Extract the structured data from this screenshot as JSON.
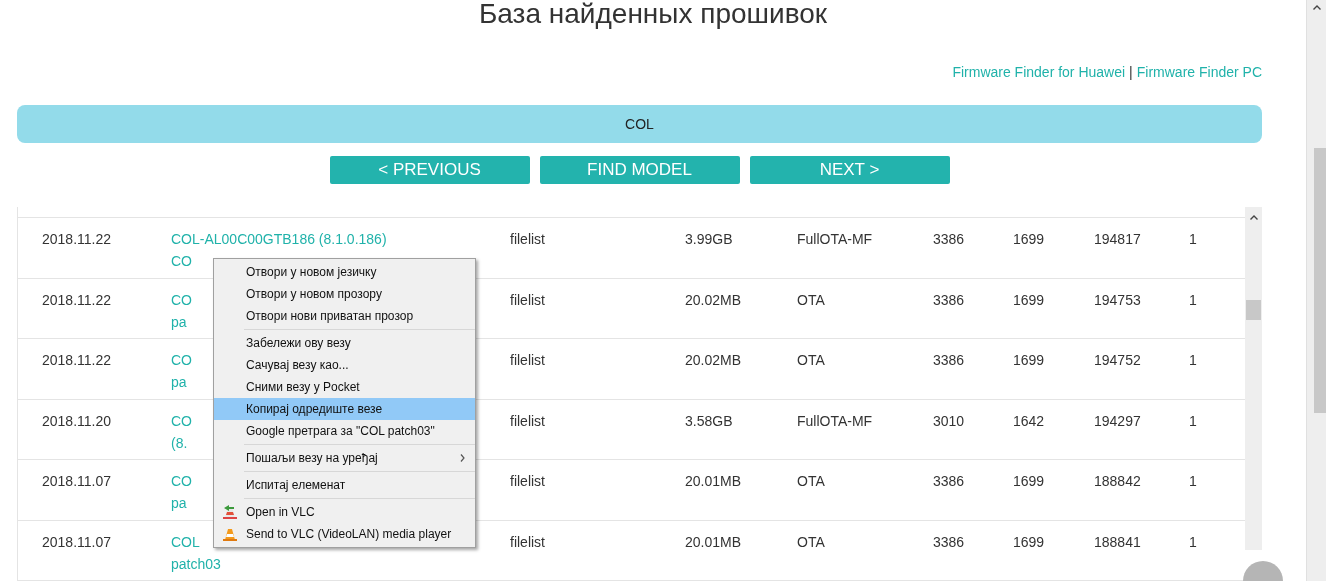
{
  "title": "База найденных прошивок",
  "links": [
    {
      "label": "Firmware Finder for Huawei"
    },
    {
      "label": "Firmware Finder PC"
    }
  ],
  "link_separator": "|",
  "model_bar": {
    "label": "COL"
  },
  "buttons": [
    {
      "label": "< PREVIOUS"
    },
    {
      "label": "FIND MODEL"
    },
    {
      "label": "NEXT >"
    }
  ],
  "table": {
    "rows": [
      {
        "date": "2018.11.22",
        "name": [
          "COL-AL00C00GTB186 (8.1.0.186)",
          "CO"
        ],
        "list": "filelist",
        "size": "3.99GB",
        "type": "FullOTA-MF",
        "column_6": "3386",
        "column_7": "1699",
        "column_8": "194817",
        "column_9": "1"
      },
      {
        "date": "2018.11.22",
        "name": [
          "CO",
          "pa"
        ],
        "list": "filelist",
        "size": "20.02MB",
        "type": "OTA",
        "column_6": "3386",
        "column_7": "1699",
        "column_8": "194753",
        "column_9": "1"
      },
      {
        "date": "2018.11.22",
        "name": [
          "CO",
          "pa"
        ],
        "list": "filelist",
        "size": "20.02MB",
        "type": "OTA",
        "column_6": "3386",
        "column_7": "1699",
        "column_8": "194752",
        "column_9": "1"
      },
      {
        "date": "2018.11.20",
        "name": [
          "CO",
          "(8."
        ],
        "list": "filelist",
        "size": "3.58GB",
        "type": "FullOTA-MF",
        "column_6": "3010",
        "column_7": "1642",
        "column_8": "194297",
        "column_9": "1"
      },
      {
        "date": "2018.11.07",
        "name": [
          "CO",
          "pa"
        ],
        "list": "filelist",
        "size": "20.01MB",
        "type": "OTA",
        "column_6": "3386",
        "column_7": "1699",
        "column_8": "188842",
        "column_9": "1"
      },
      {
        "date": "2018.11.07",
        "name": [
          "COL",
          "patch03"
        ],
        "list": "filelist",
        "size": "20.01MB",
        "type": "OTA",
        "column_6": "3386",
        "column_7": "1699",
        "column_8": "188841",
        "column_9": "1"
      }
    ]
  },
  "context_menu": {
    "groups": [
      [
        {
          "label": "Отвори у новом језичку",
          "selected": false
        },
        {
          "label": "Отвори у новом прозору",
          "selected": false
        },
        {
          "label": "Отвори нови приватан прозор",
          "selected": false
        }
      ],
      [
        {
          "label": "Забележи ову везу",
          "selected": false
        },
        {
          "label": "Сачувај везу као...",
          "selected": false
        },
        {
          "label": "Сними везу у Pocket",
          "selected": false
        },
        {
          "label": "Копирај одредиште везе",
          "selected": true
        },
        {
          "label": "Google претрага за \"COL patch03\"",
          "selected": false
        }
      ],
      [
        {
          "label": "Пошаљи везу на уређај",
          "selected": false,
          "kind": "submenu"
        }
      ],
      [
        {
          "label": "Испитај елеменат",
          "selected": false
        }
      ],
      [
        {
          "label": "Open in VLC",
          "selected": false,
          "kind": "open-vlc"
        },
        {
          "label": "Send to VLC (VideoLAN) media player",
          "selected": false,
          "kind": "send-vlc"
        }
      ]
    ]
  }
}
